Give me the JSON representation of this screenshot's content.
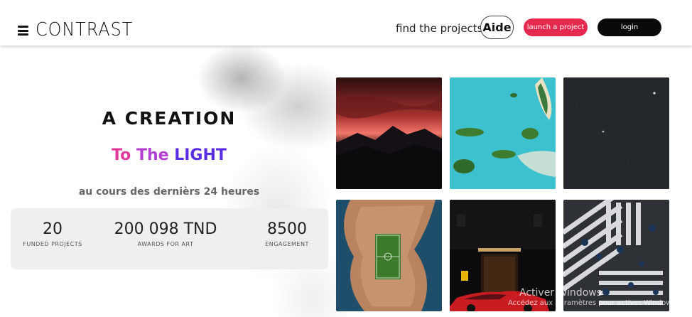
{
  "header": {
    "logo": "CONTRAST",
    "find_label": "find the projects",
    "aide_label": "Aide",
    "launch_label": "launch a project",
    "login_label": "login"
  },
  "hero": {
    "title": "A CREATION",
    "subtitle_parts": [
      "To",
      "The",
      "LIGHT"
    ],
    "caption": "au cours des dernièrs 24 heures"
  },
  "stats": [
    {
      "value": "20",
      "label": "FUNDED PROJECTS"
    },
    {
      "value": "200 098 TND",
      "label": "AWARDS FOR ART"
    },
    {
      "value": "8500",
      "label": "ENGAGEMENT"
    }
  ],
  "gallery": [
    {
      "name": "sunset-mountains"
    },
    {
      "name": "turquoise-islands"
    },
    {
      "name": "dark-ocean"
    },
    {
      "name": "island-football-field"
    },
    {
      "name": "red-car-hotel"
    },
    {
      "name": "crosswalk-umbrellas"
    }
  ],
  "watermark": {
    "line1": "Activer Windows",
    "line2": "Accédez aux paramètres pour activer Windows."
  },
  "colors": {
    "launch_button": "#e5294f",
    "login_button": "#0a0a0a",
    "subtitle_to": "#e03a9c",
    "subtitle_the": "#b43fd0",
    "subtitle_light": "#5b2de0"
  }
}
